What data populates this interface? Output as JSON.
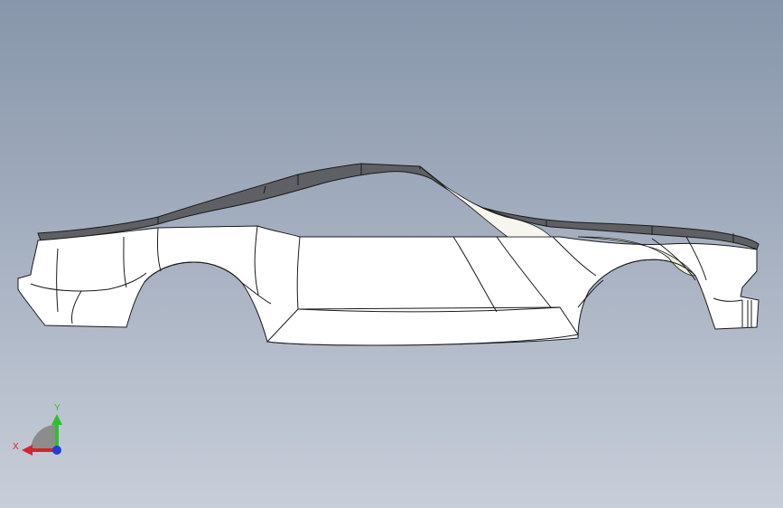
{
  "viewport": {
    "background_top": "#8796aa",
    "background_bottom": "#c8ced9",
    "model": {
      "description_icon": "car-body-surface-model",
      "surface_color": "#ffffff",
      "edge_color": "#1a1a1a",
      "trim_color": "#5e6064"
    }
  },
  "triad": {
    "x_label": "X",
    "y_label": "Y",
    "x_color": "#d4242a",
    "y_color": "#2fbf2f",
    "z_color": "#1f3fd6"
  }
}
